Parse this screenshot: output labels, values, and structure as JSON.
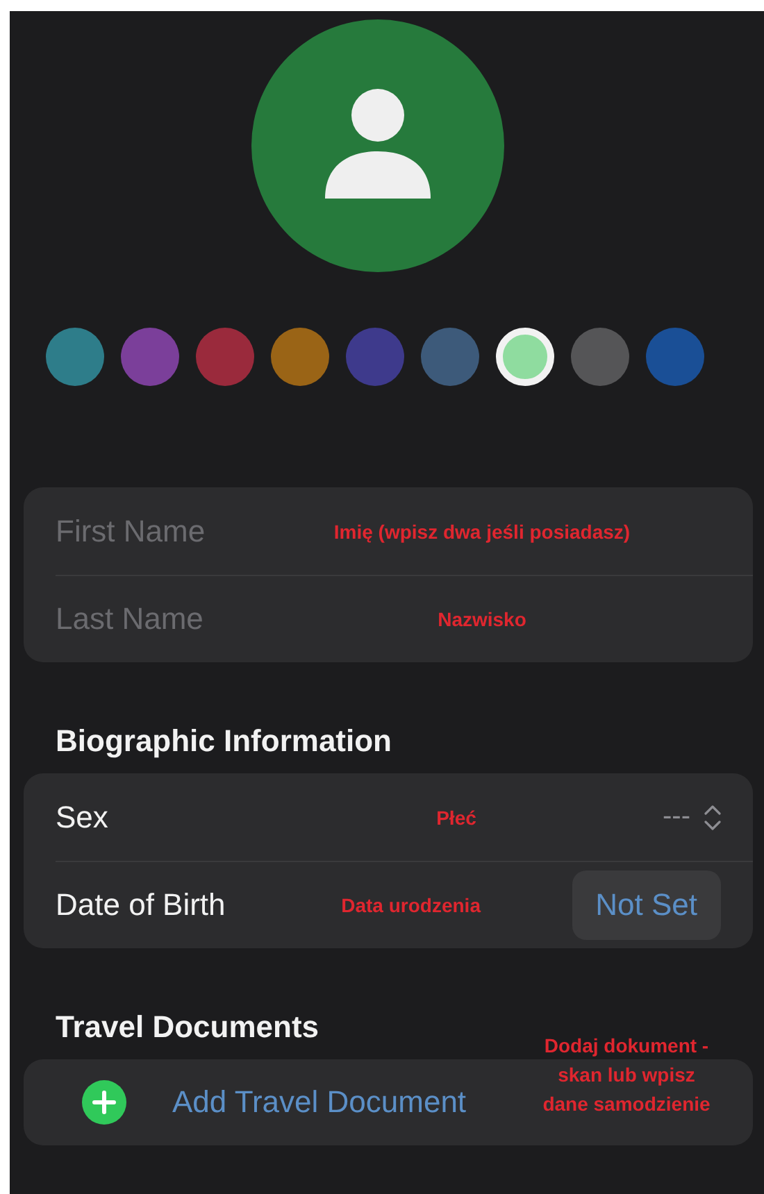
{
  "avatar": {
    "color": "#267a3c"
  },
  "colors": [
    {
      "color": "#2e7d8a",
      "selected": false
    },
    {
      "color": "#7b3f9a",
      "selected": false
    },
    {
      "color": "#9a2a3c",
      "selected": false
    },
    {
      "color": "#9a6416",
      "selected": false
    },
    {
      "color": "#3e3a8c",
      "selected": false
    },
    {
      "color": "#3d5a7a",
      "selected": false
    },
    {
      "color": "#8fdc9f",
      "selected": true
    },
    {
      "color": "#555557",
      "selected": false
    },
    {
      "color": "#1a4f96",
      "selected": false
    }
  ],
  "name_fields": [
    {
      "placeholder": "First Name",
      "note": "Imię (wpisz dwa jeśli posiadasz)"
    },
    {
      "placeholder": "Last Name",
      "note": "Nazwisko"
    }
  ],
  "biographic": {
    "title": "Biographic Information",
    "rows": [
      {
        "kind": "picker",
        "label": "Sex",
        "note": "Płeć",
        "value": "---"
      },
      {
        "kind": "date",
        "label": "Date of Birth",
        "note": "Data urodzenia",
        "value": "Not Set"
      }
    ]
  },
  "travel": {
    "title": "Travel Documents",
    "action": "Add Travel Document",
    "note": "Dodaj dokument - skan lub wpisz dane samodzienie"
  }
}
